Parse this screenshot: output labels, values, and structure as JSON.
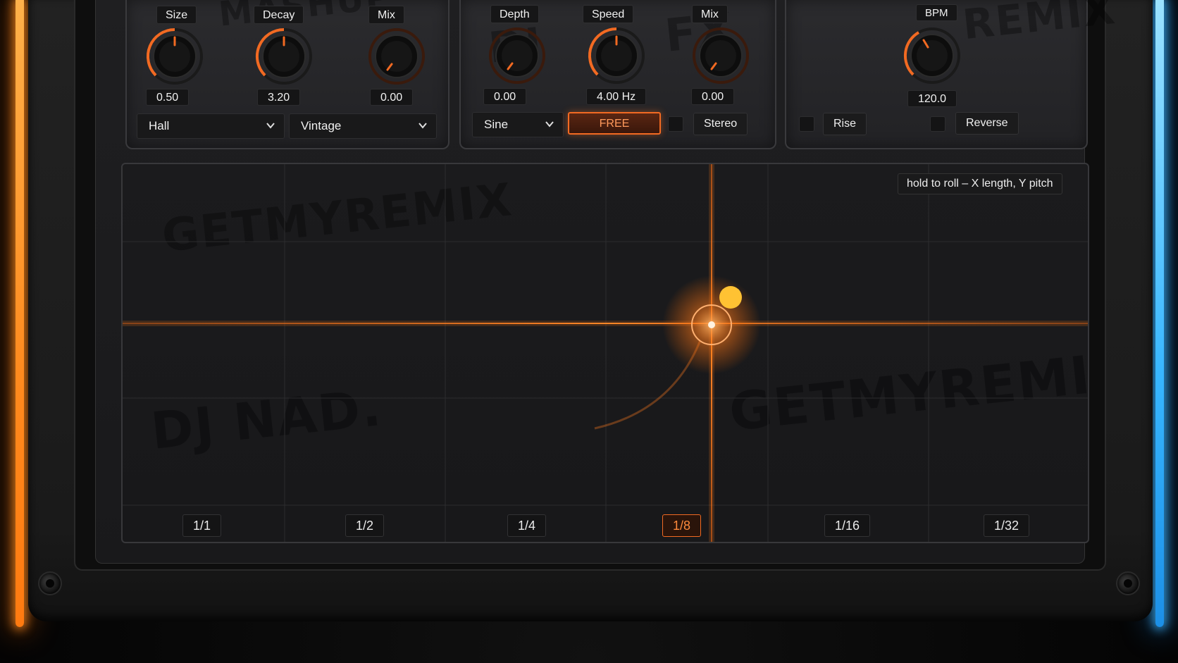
{
  "reverb": {
    "knobs": [
      {
        "label": "Size",
        "value": "0.50"
      },
      {
        "label": "Decay",
        "value": "3.20"
      },
      {
        "label": "Mix",
        "value": "0.00"
      }
    ],
    "selects": [
      {
        "value": "Hall",
        "icon": "chevron-down-icon"
      },
      {
        "value": "Vintage",
        "icon": "chevron-down-icon"
      }
    ]
  },
  "modulation": {
    "knobs": [
      {
        "label": "Depth",
        "value": "0.00"
      },
      {
        "label": "Speed",
        "value": "4.00 Hz"
      },
      {
        "label": "Mix",
        "value": "0.00"
      }
    ],
    "waveform": "Sine",
    "sync_button": "FREE",
    "stereo_label": "Stereo"
  },
  "roll": {
    "bpm_label": "BPM",
    "bpm_value": "120.0",
    "rise_label": "Rise",
    "reverse_label": "Reverse"
  },
  "pad": {
    "hint": "hold to roll – X length, Y pitch",
    "divisions": [
      "1/1",
      "1/2",
      "1/4",
      "1/8",
      "1/16",
      "1/32"
    ],
    "active_division": "1/8"
  },
  "graffiti": [
    "GETMYREMIX",
    "DJ NAD.",
    "GETMYREMIX",
    "MASHUP",
    "DJ",
    "FX",
    "REMIX"
  ],
  "colors": {
    "accent": "#f26a22",
    "accent_glow": "#ff8a1e",
    "left_neon": "#ff8a1e",
    "right_neon": "#37b6ff",
    "panel": "#2b2b2e",
    "cursor_dot": "#ffc233"
  }
}
